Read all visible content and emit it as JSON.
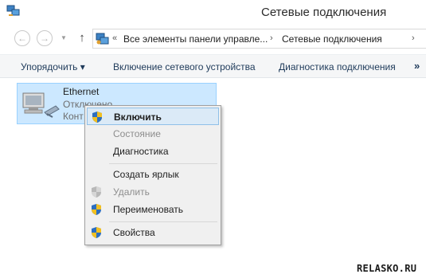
{
  "window": {
    "title": "Сетевые подключения"
  },
  "nav": {
    "back_icon": "back-arrow-icon",
    "forward_icon": "forward-arrow-icon",
    "up_icon": "up-arrow-icon"
  },
  "address": {
    "overflow": "«",
    "segments": [
      "Все элементы панели управле...",
      "Сетевые подключения"
    ],
    "separator": "›"
  },
  "commands": {
    "organize": "Упорядочить ▾",
    "enable_device": "Включение сетевого устройства",
    "diagnose": "Диагностика подключения",
    "more": "»"
  },
  "connection": {
    "name": "Ethernet",
    "status": "Отключено",
    "device": "Конт"
  },
  "context_menu": {
    "items": [
      {
        "label": "Включить",
        "icon": "uac-shield-icon",
        "bold": true,
        "disabled": false,
        "highlighted": true
      },
      {
        "label": "Состояние",
        "icon": "",
        "bold": false,
        "disabled": true,
        "highlighted": false
      },
      {
        "label": "Диагностика",
        "icon": "",
        "bold": false,
        "disabled": false,
        "highlighted": false
      },
      {
        "label": "Создать ярлык",
        "icon": "",
        "bold": false,
        "disabled": false,
        "highlighted": false
      },
      {
        "label": "Удалить",
        "icon": "uac-shield-icon",
        "bold": false,
        "disabled": true,
        "highlighted": false
      },
      {
        "label": "Переименовать",
        "icon": "uac-shield-icon",
        "bold": false,
        "disabled": false,
        "highlighted": false
      },
      {
        "label": "Свойства",
        "icon": "uac-shield-icon",
        "bold": false,
        "disabled": false,
        "highlighted": false
      }
    ]
  },
  "watermark": "RELASKO.RU",
  "colors": {
    "selection": "#cce8ff",
    "menu_highlight": "#dbeaf7",
    "command_text": "#1e3a5a"
  }
}
